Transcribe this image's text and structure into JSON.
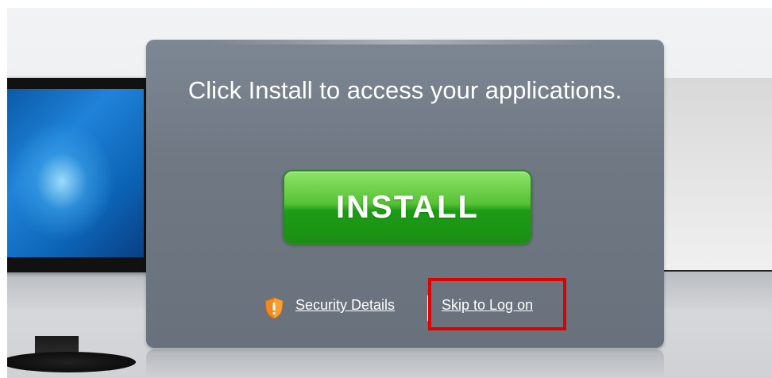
{
  "dialog": {
    "title": "Click Install to access your applications.",
    "install_label": "INSTALL",
    "security_label": "Security Details",
    "skip_label": "Skip to Log on"
  },
  "colors": {
    "panel": "#6f7883",
    "install_button": "#3aa828",
    "highlight": "#e00000"
  },
  "icons": {
    "security": "shield-warning-icon"
  }
}
